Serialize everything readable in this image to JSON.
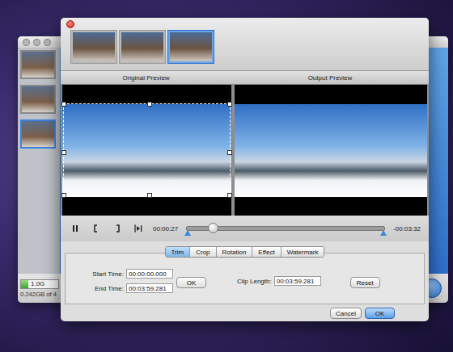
{
  "back_window": {
    "thumbnails": [
      {
        "selected": false
      },
      {
        "selected": false
      },
      {
        "selected": true
      }
    ],
    "storage": {
      "reading": "1.0G",
      "level": 0.2,
      "caption": "0.242GB of 4"
    }
  },
  "dialog": {
    "thumbnails": [
      {
        "selected": false
      },
      {
        "selected": false
      },
      {
        "selected": true
      }
    ],
    "previews": [
      {
        "heading": "Original Preview",
        "crop_frame": true
      },
      {
        "heading": "Output Preview",
        "crop_frame": false
      }
    ],
    "player": {
      "playing": true,
      "elapsed": "00:00:27",
      "remaining": "-00:03:32",
      "level": 0.13
    },
    "tabs": [
      {
        "label": "Trim",
        "selected": true
      },
      {
        "label": "Crop",
        "selected": false
      },
      {
        "label": "Rotation",
        "selected": false
      },
      {
        "label": "Effect",
        "selected": false
      },
      {
        "label": "Watermark",
        "selected": false
      }
    ],
    "trim": {
      "start_label": "Start Time:",
      "start": "00:00:00.000",
      "end_label": "End Time:",
      "end": "00:03:59.281",
      "apply": "OK",
      "clip_label": "Clip Length:",
      "clip": "00:03:59.281",
      "reset": "Reset"
    },
    "buttons": [
      {
        "label": "Cancel",
        "default": false
      },
      {
        "label": "OK",
        "default": true
      }
    ]
  }
}
